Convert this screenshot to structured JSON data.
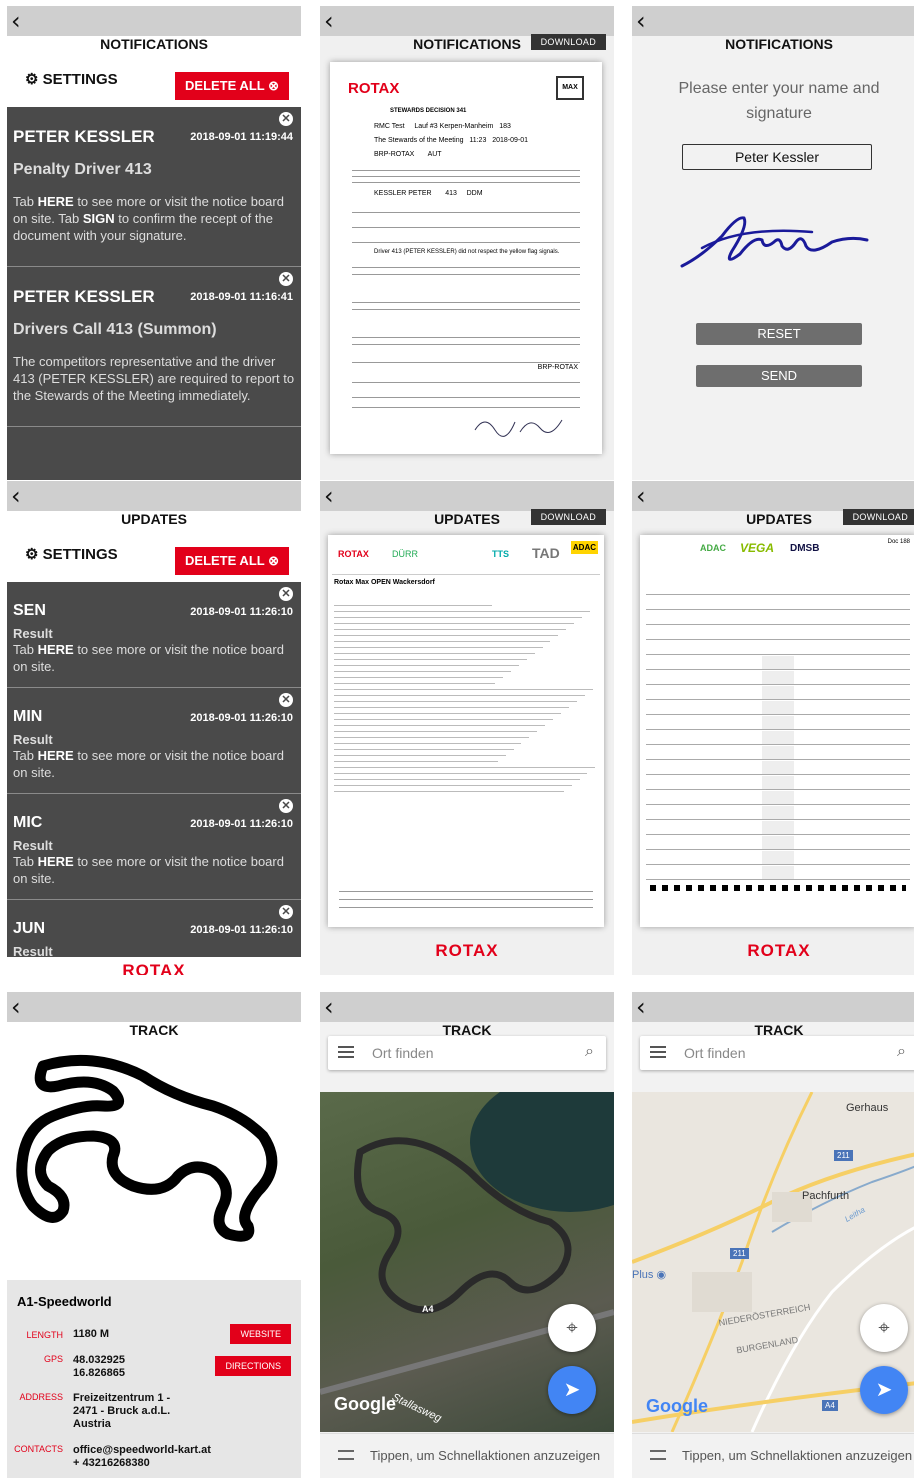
{
  "notifications": {
    "title": "NOTIFICATIONS",
    "settings_label": "SETTINGS",
    "delete_all_label": "DELETE ALL",
    "download_label": "DOWNLOAD",
    "items": [
      {
        "name": "PETER KESSLER",
        "date": "2018-09-01 11:19:44",
        "subject": "Penalty Driver 413",
        "body_pre": "Tab ",
        "here": "HERE",
        "body_mid": " to see more or visit the notice board on site. Tab ",
        "sign": "SIGN",
        "body_post": " to confirm the recept of the document with your signature."
      },
      {
        "name": "PETER KESSLER",
        "date": "2018-09-01 11:16:41",
        "subject": "Drivers Call 413 (Summon)",
        "body": "The competitors representative and the driver 413 (PETER KESSLER) are required to report to the Stewards of the Meeting immediately."
      }
    ]
  },
  "steward_doc": {
    "brand": "ROTAX",
    "decision_label": "STEWARDS DECISION",
    "decision_no": "341",
    "event": "RMC Test",
    "venue": "Lauf #3 Kerpen-Manheim",
    "doc_no": "183",
    "from": "The Stewards of the Meeting",
    "time": "11:23",
    "date": "2018-09-01",
    "to": "BRP-ROTAX",
    "nat": "AUT",
    "driver": "KESSLER PETER",
    "car_no": "413",
    "class": "DDM",
    "fact": "Driver 413 (PETER KESSLER) did not respect the yellow flag signals.",
    "representing": "BRP-ROTAX"
  },
  "signature": {
    "title": "NOTIFICATIONS",
    "prompt": "Please enter your name and signature",
    "name_value": "Peter Kessler",
    "reset_label": "RESET",
    "send_label": "SEND"
  },
  "updates": {
    "title": "UPDATES",
    "settings_label": "SETTINGS",
    "delete_all_label": "DELETE ALL",
    "download_label": "DOWNLOAD",
    "brand": "ROTAX",
    "items": [
      {
        "name": "SEN",
        "date": "2018-09-01 11:26:10",
        "subject": "Result",
        "body_pre": "Tab ",
        "here": "HERE",
        "body_post": " to see more or visit the notice board on site."
      },
      {
        "name": "MIN",
        "date": "2018-09-01 11:26:10",
        "subject": "Result",
        "body_pre": "Tab ",
        "here": "HERE",
        "body_post": " to see more or visit the notice board on site."
      },
      {
        "name": "MIC",
        "date": "2018-09-01 11:26:10",
        "subject": "Result",
        "body_pre": "Tab ",
        "here": "HERE",
        "body_post": " to see more or visit the notice board on site."
      },
      {
        "name": "JUN",
        "date": "2018-09-01 11:26:10",
        "subject": "Result",
        "body_pre": "",
        "here": "",
        "body_post": ""
      }
    ],
    "result_doc": {
      "title": "Rotax Max OPEN Wackersdorf",
      "sponsor": "ADAC"
    },
    "grid_doc": {
      "sponsor": "DMSB",
      "page": "Doc 188"
    }
  },
  "track": {
    "title": "TRACK",
    "name": "A1-Speedworld",
    "length_label": "LENGTH",
    "length": "1180 M",
    "gps_label": "GPS",
    "gps_lat": "48.032925",
    "gps_lon": "16.826865",
    "address_label": "ADDRESS",
    "address": [
      "Freizeitzentrum 1 -",
      "2471 - Bruck a.d.L.",
      "Austria"
    ],
    "contacts_label": "CONTACTS",
    "contacts": [
      "office@speedworld-kart.at",
      "+ 43216268380"
    ],
    "website_label": "WEBSITE",
    "directions_label": "DIRECTIONS"
  },
  "map": {
    "search_placeholder": "Ort finden",
    "footer_text": "Tippen, um Schnellaktionen anzuzeigen",
    "google": "Google",
    "street": "Stallasweg",
    "road_a4": "A4",
    "places": [
      "Gerhaus",
      "Pachfurth",
      "Leitha",
      "Plus",
      "NIEDERÖSTERREICH",
      "BURGENLAND"
    ],
    "route_211": "211",
    "route_211b": "211"
  },
  "colors": {
    "accent": "#e2001a",
    "dark": "#4a4a4a",
    "bar": "#cfcfcf",
    "google_blue": "#4285f4"
  }
}
